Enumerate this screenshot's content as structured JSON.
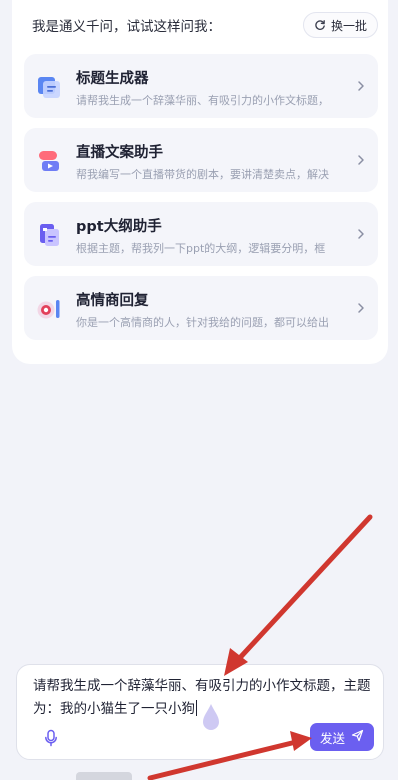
{
  "header": {
    "intro": "我是通义千问，试试这样问我：",
    "refresh_label": "换一批"
  },
  "cards": [
    {
      "title": "标题生成器",
      "desc": "请帮我生成一个辞藻华丽、有吸引力的小作文标题，",
      "icon": "document-text-icon"
    },
    {
      "title": "直播文案助手",
      "desc": "帮我编写一个直播带货的剧本，要讲清楚卖点，解决",
      "icon": "live-stream-icon"
    },
    {
      "title": "ppt大纲助手",
      "desc": "根据主题，帮我列一下ppt的大纲，逻辑要分明，框",
      "icon": "slides-icon"
    },
    {
      "title": "高情商回复",
      "desc": "你是一个高情商的人，针对我给的问题，都可以给出",
      "icon": "chat-bulb-icon"
    }
  ],
  "composer": {
    "text": "请帮我生成一个辞藻华丽、有吸引力的小作文标题，主题为：我的小猫生了一只小狗",
    "send_label": "发送"
  },
  "colors": {
    "accent": "#6b5ff0",
    "arrow": "#d0372f",
    "background": "#f2f3f9"
  }
}
